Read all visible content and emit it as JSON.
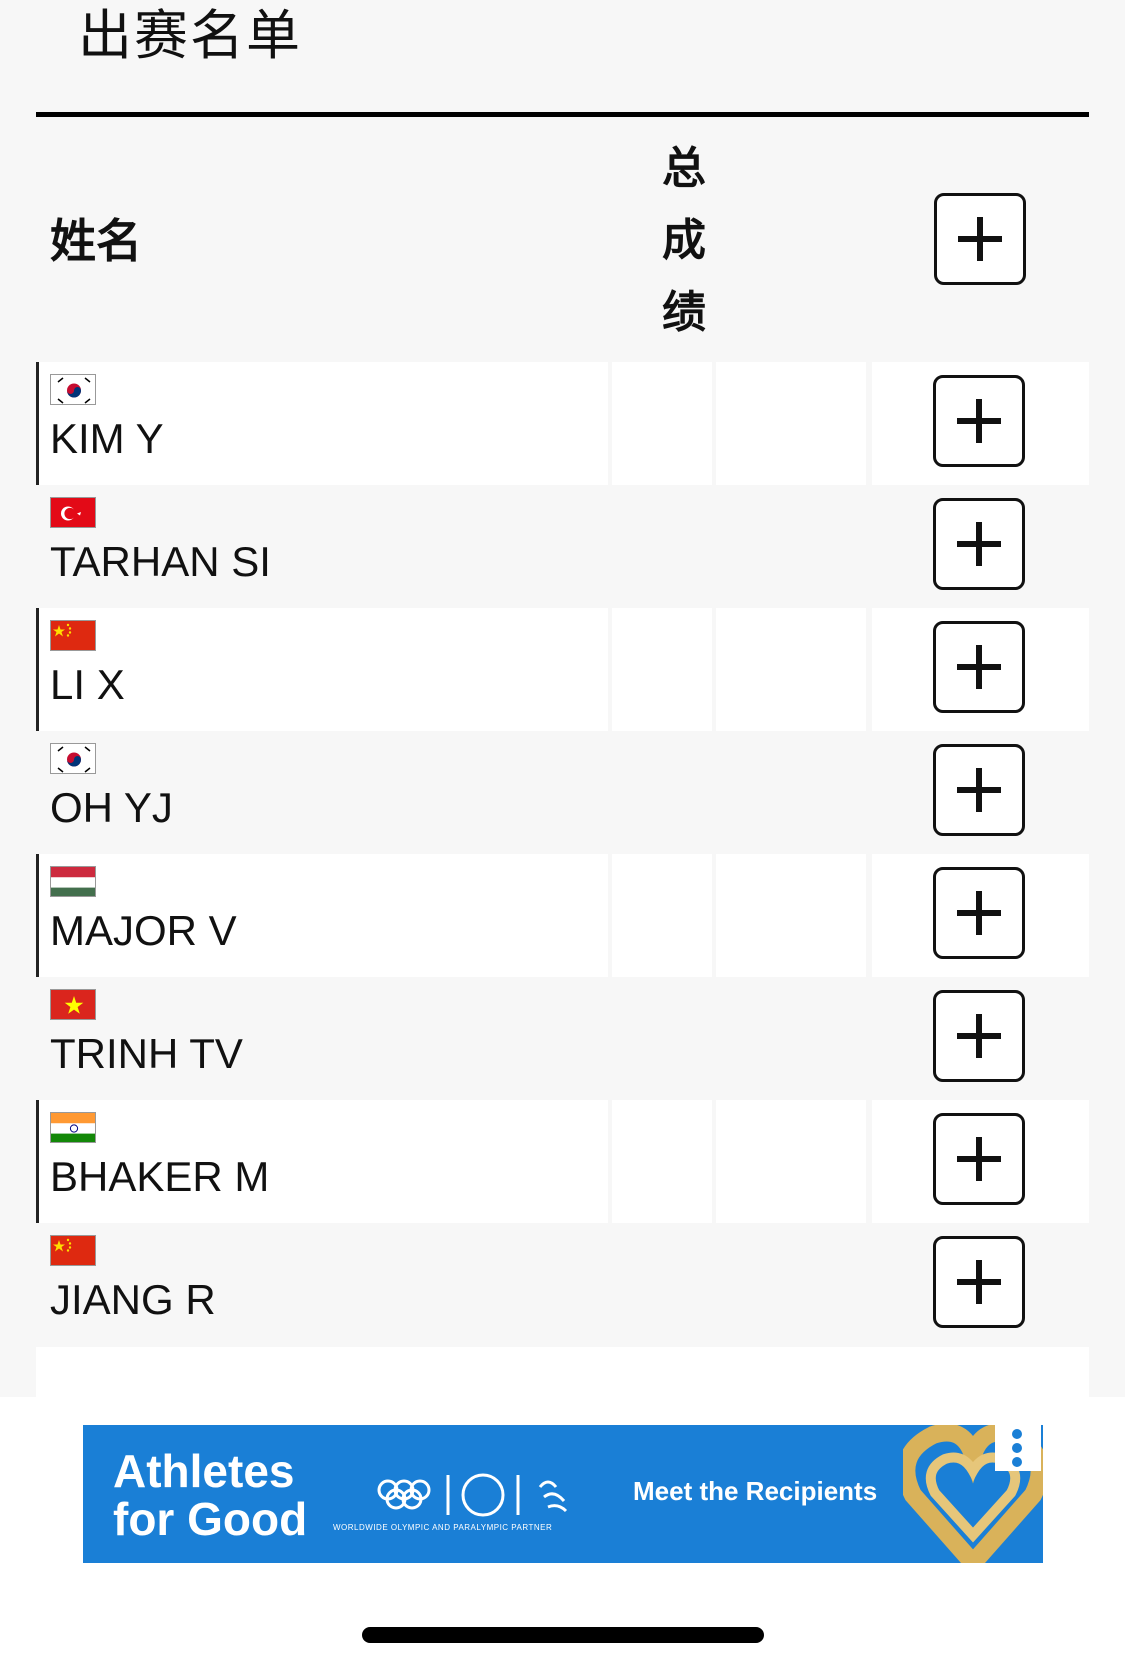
{
  "page": {
    "title": "出赛名单"
  },
  "table": {
    "headers": {
      "name": "姓名",
      "total_chars": [
        "总",
        "成",
        "绩"
      ]
    },
    "rows": [
      {
        "name": "KIM Y",
        "flag": "kor"
      },
      {
        "name": "TARHAN SI",
        "flag": "tur"
      },
      {
        "name": "LI X",
        "flag": "chn"
      },
      {
        "name": "OH YJ",
        "flag": "kor"
      },
      {
        "name": "MAJOR V",
        "flag": "hun"
      },
      {
        "name": "TRINH TV",
        "flag": "vie"
      },
      {
        "name": "BHAKER M",
        "flag": "ind"
      },
      {
        "name": "JIANG R",
        "flag": "chn"
      }
    ]
  },
  "ad": {
    "headline": "Athletes for Good",
    "partner_text": "WORLDWIDE OLYMPIC AND PARALYMPIC PARTNER",
    "cta": "Meet the Recipients",
    "brand_color": "#1a7fd6"
  }
}
